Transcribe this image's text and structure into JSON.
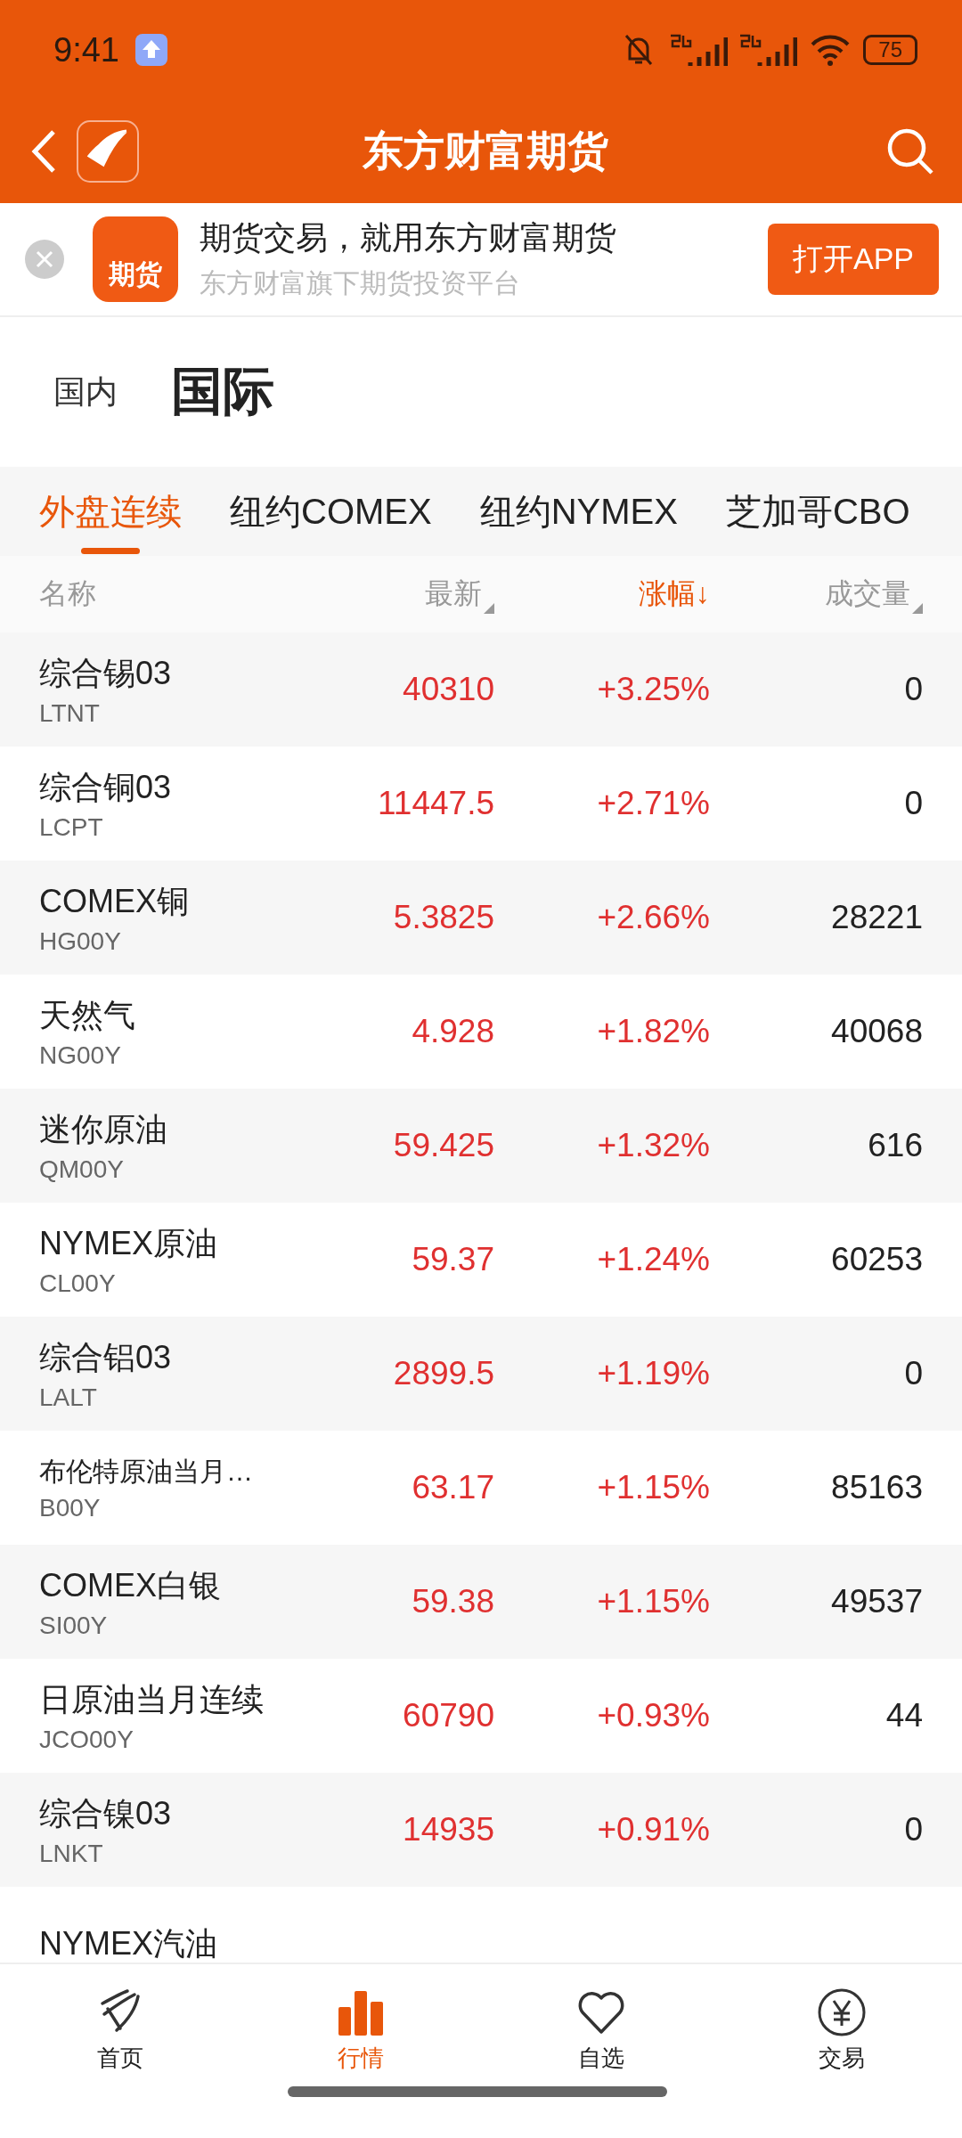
{
  "status_bar": {
    "time": "9:41",
    "battery": "75"
  },
  "header": {
    "title": "东方财富期货"
  },
  "banner": {
    "app_icon_label": "期货",
    "title": "期货交易，就用东方财富期货",
    "subtitle": "东方财富旗下期货投资平台",
    "button": "打开APP"
  },
  "market_tabs": [
    {
      "label": "国内",
      "selected": false
    },
    {
      "label": "国际",
      "selected": true
    }
  ],
  "exchange_tabs": [
    {
      "label": "外盘连续",
      "selected": true
    },
    {
      "label": "纽约COMEX",
      "selected": false
    },
    {
      "label": "纽约NYMEX",
      "selected": false
    },
    {
      "label": "芝加哥CBO",
      "selected": false
    }
  ],
  "table": {
    "columns": [
      {
        "label": "名称",
        "kind": "plain",
        "selected": false
      },
      {
        "label": "最新",
        "kind": "sortable",
        "selected": false
      },
      {
        "label": "涨幅↓",
        "kind": "sortable",
        "selected": true
      },
      {
        "label": "成交量",
        "kind": "sortable",
        "selected": false
      }
    ],
    "rows": [
      {
        "name": "综合锡03",
        "code": "LTNT",
        "last": "40310",
        "change": "+3.25%",
        "volume": "0"
      },
      {
        "name": "综合铜03",
        "code": "LCPT",
        "last": "11447.5",
        "change": "+2.71%",
        "volume": "0"
      },
      {
        "name": "COMEX铜",
        "code": "HG00Y",
        "last": "5.3825",
        "change": "+2.66%",
        "volume": "28221"
      },
      {
        "name": "天然气",
        "code": "NG00Y",
        "last": "4.928",
        "change": "+1.82%",
        "volume": "40068"
      },
      {
        "name": "迷你原油",
        "code": "QM00Y",
        "last": "59.425",
        "change": "+1.32%",
        "volume": "616"
      },
      {
        "name": "NYMEX原油",
        "code": "CL00Y",
        "last": "59.37",
        "change": "+1.24%",
        "volume": "60253"
      },
      {
        "name": "综合铝03",
        "code": "LALT",
        "last": "2899.5",
        "change": "+1.19%",
        "volume": "0"
      },
      {
        "name": "布伦特原油当月…",
        "code": "B00Y",
        "last": "63.17",
        "change": "+1.15%",
        "volume": "85163"
      },
      {
        "name": "COMEX白银",
        "code": "SI00Y",
        "last": "59.38",
        "change": "+1.15%",
        "volume": "49537"
      },
      {
        "name": "日原油当月连续",
        "code": "JCO00Y",
        "last": "60790",
        "change": "+0.93%",
        "volume": "44"
      },
      {
        "name": "综合镍03",
        "code": "LNKT",
        "last": "14935",
        "change": "+0.91%",
        "volume": "0"
      },
      {
        "name": "NYMEX汽油"
      }
    ]
  },
  "bottom_nav": [
    {
      "label": "首页",
      "kind": "home",
      "selected": false
    },
    {
      "label": "行情",
      "kind": "market",
      "selected": true
    },
    {
      "label": "自选",
      "kind": "watchlist",
      "selected": false
    },
    {
      "label": "交易",
      "kind": "trade",
      "selected": false
    }
  ]
}
